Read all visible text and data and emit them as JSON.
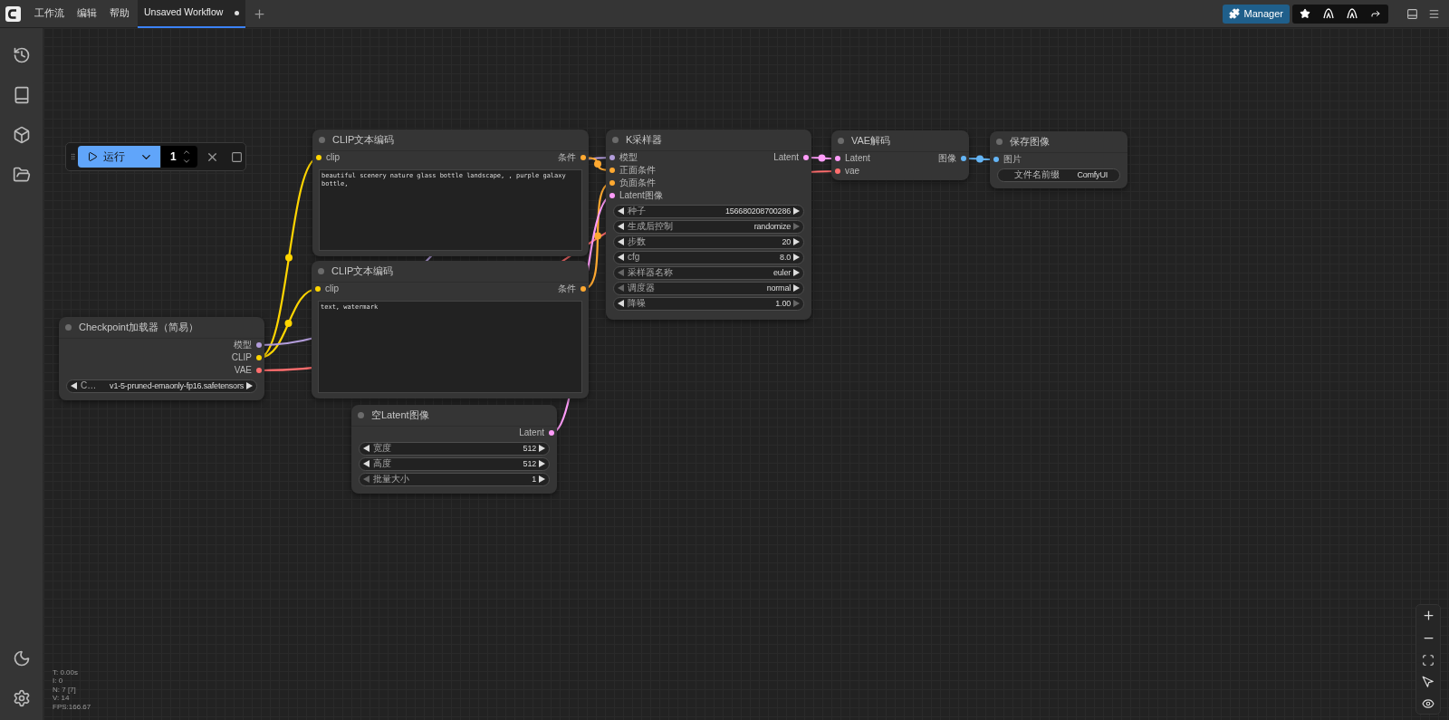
{
  "top_bar": {
    "menu": [
      "工作流",
      "编辑",
      "帮助"
    ],
    "tabs": [
      {
        "label": "Unsaved Workflow",
        "selected": true,
        "modified": true
      }
    ],
    "manager_button": "Manager"
  },
  "run_toolbar": {
    "run_label": "运行",
    "count": "1"
  },
  "nodes": [
    {
      "title": "CLIP文本编码",
      "inputs": [
        {
          "label": "clip",
          "color": "#ffd500"
        }
      ],
      "outputs": [
        {
          "label": "条件",
          "color": "#ffa931"
        }
      ],
      "text": "beautiful scenery nature glass bottle landscape, , purple galaxy bottle,"
    },
    {
      "title": "K采样器",
      "inputs": [
        {
          "label": "模型",
          "color": "#b39ddb"
        },
        {
          "label": "正面条件",
          "color": "#ffa931"
        },
        {
          "label": "负面条件",
          "color": "#ffa931"
        },
        {
          "label": "Latent图像",
          "color": "#ff9cf9"
        }
      ],
      "outputs": [
        {
          "label": "Latent",
          "color": "#ff9cf9"
        }
      ],
      "widgets": [
        {
          "kind": "number",
          "label": "种子",
          "value": "156680208700286",
          "at_min": false,
          "at_max": false
        },
        {
          "kind": "combo",
          "label": "生成后控制",
          "value": "randomize",
          "at_min": false,
          "at_max": true
        },
        {
          "kind": "number",
          "label": "步数",
          "value": "20",
          "at_min": false,
          "at_max": false
        },
        {
          "kind": "number",
          "label": "cfg",
          "value": "8.0",
          "at_min": false,
          "at_max": false
        },
        {
          "kind": "combo",
          "label": "采样器名称",
          "value": "euler",
          "at_min": true,
          "at_max": false
        },
        {
          "kind": "combo",
          "label": "调度器",
          "value": "normal",
          "at_min": true,
          "at_max": false
        },
        {
          "kind": "number",
          "label": "降噪",
          "value": "1.00",
          "at_min": false,
          "at_max": true
        }
      ]
    },
    {
      "title": "VAE解码",
      "inputs": [
        {
          "label": "Latent",
          "color": "#ff9cf9"
        },
        {
          "label": "vae",
          "color": "#ff6e6e"
        }
      ],
      "outputs": [
        {
          "label": "图像",
          "color": "#64b5f6"
        }
      ]
    },
    {
      "title": "保存图像",
      "inputs": [
        {
          "label": "图片",
          "color": "#64b5f6"
        }
      ],
      "widgets": [
        {
          "kind": "text",
          "label": "文件名前缀",
          "value": "ComfyUI"
        }
      ]
    },
    {
      "title": "CLIP文本编码",
      "inputs": [
        {
          "label": "clip",
          "color": "#ffd500"
        }
      ],
      "outputs": [
        {
          "label": "条件",
          "color": "#ffa931"
        }
      ],
      "text": "text, watermark"
    },
    {
      "title": "Checkpoint加载器（简易）",
      "outputs": [
        {
          "label": "模型",
          "color": "#b39ddb"
        },
        {
          "label": "CLIP",
          "color": "#ffd500"
        },
        {
          "label": "VAE",
          "color": "#ff6e6e"
        }
      ],
      "widgets": [
        {
          "kind": "combo",
          "label": "C…",
          "value": "v1-5-pruned-emaonly-fp16.safetensors",
          "at_min": false,
          "at_max": false
        }
      ]
    },
    {
      "title": "空Latent图像",
      "outputs": [
        {
          "label": "Latent",
          "color": "#ff9cf9"
        }
      ],
      "widgets": [
        {
          "kind": "number",
          "label": "宽度",
          "value": "512",
          "at_min": false,
          "at_max": false
        },
        {
          "kind": "number",
          "label": "高度",
          "value": "512",
          "at_min": false,
          "at_max": false
        },
        {
          "kind": "number",
          "label": "批量大小",
          "value": "1",
          "at_min": true,
          "at_max": false
        }
      ]
    }
  ],
  "stats": [
    "T: 0.00s",
    "I: 0",
    "N: 7 [7]",
    "V: 14",
    "FPS:166.67"
  ]
}
